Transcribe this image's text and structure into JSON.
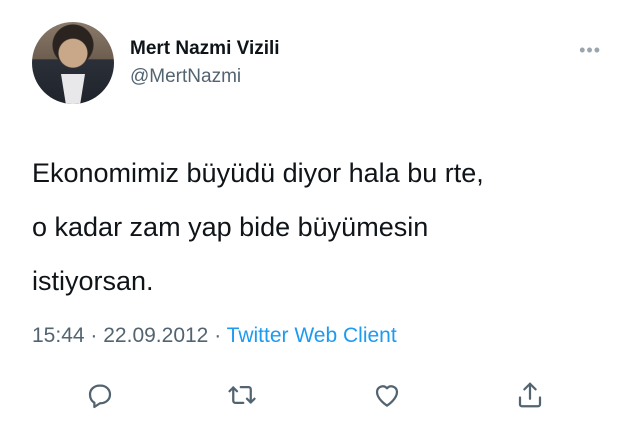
{
  "author": {
    "display_name": "Mert Nazmi Vizili",
    "handle": "@MertNazmi"
  },
  "tweet": {
    "lines": [
      "Ekonomimiz büyüdü diyor hala bu rte,",
      "o kadar zam yap bide büyümesin",
      "istiyorsan."
    ],
    "time": "15:44",
    "date": "22.09.2012",
    "separator": "·",
    "client": "Twitter Web Client"
  },
  "menu": {
    "glyph": "•••"
  },
  "actions": [
    {
      "name": "reply",
      "icon": "reply-icon"
    },
    {
      "name": "retweet",
      "icon": "retweet-icon"
    },
    {
      "name": "like",
      "icon": "heart-icon"
    },
    {
      "name": "share",
      "icon": "share-icon"
    }
  ],
  "colors": {
    "text": "#0f1419",
    "secondary": "#536471",
    "accent": "#1d9bf0"
  }
}
